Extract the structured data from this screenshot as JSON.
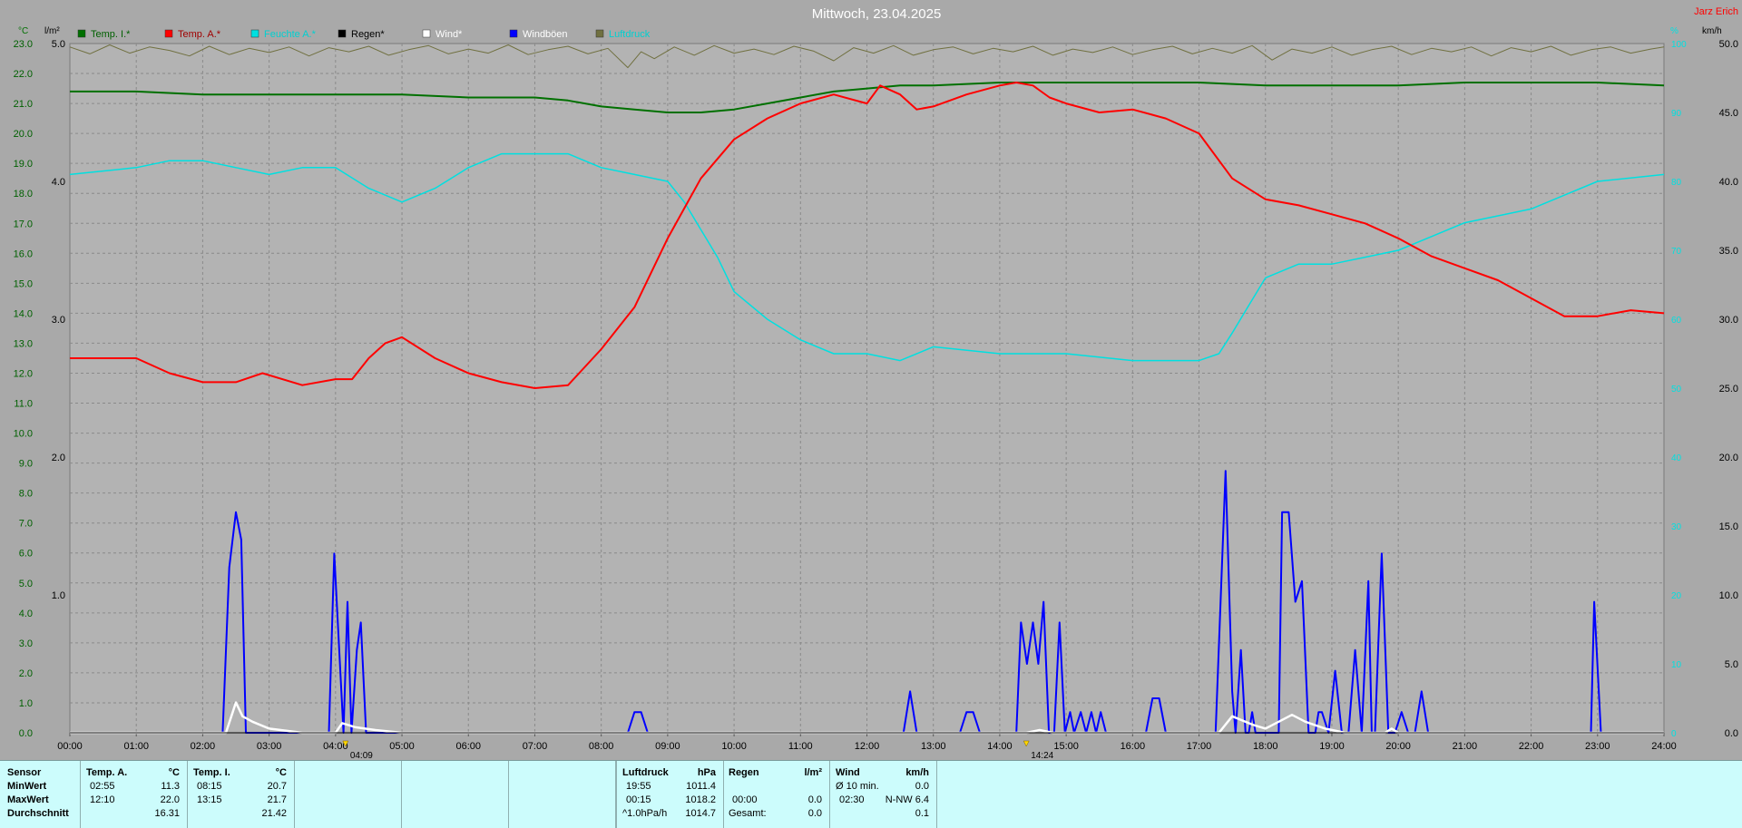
{
  "title": "Mittwoch, 23.04.2025",
  "author": "Jarz Erich",
  "units": {
    "temp": "°C",
    "rain": "l/m²",
    "wind": "km/h",
    "humidity": "%"
  },
  "colors": {
    "temp_inside": "#007000",
    "temp_outside": "#ff0000",
    "humidity": "#00e0e0",
    "rain": "#000000",
    "wind": "#ffffff",
    "gusts": "#0000ff",
    "pressure": "#707040"
  },
  "legend": [
    {
      "label": "Temp. I.*",
      "color": "#007000",
      "text_color": "#006000"
    },
    {
      "label": "Temp. A.*",
      "color": "#ff0000",
      "text_color": "#a00000"
    },
    {
      "label": "Feuchte A.*",
      "color": "#00e0e0",
      "text_color": "#00d0d0"
    },
    {
      "label": "Regen*",
      "color": "#000000",
      "text_color": "#000000"
    },
    {
      "label": "Wind*",
      "color": "#ffffff",
      "text_color": "#ffffff"
    },
    {
      "label": "Windböen",
      "color": "#0000ff",
      "text_color": "#ffffff"
    },
    {
      "label": "Luftdruck",
      "color": "#707040",
      "text_color": "#00d0d0"
    }
  ],
  "chart_data": {
    "type": "line",
    "x_ticks": [
      "00:00",
      "01:00",
      "02:00",
      "03:00",
      "04:00",
      "05:00",
      "06:00",
      "07:00",
      "08:00",
      "09:00",
      "10:00",
      "11:00",
      "12:00",
      "13:00",
      "14:00",
      "15:00",
      "16:00",
      "17:00",
      "18:00",
      "19:00",
      "20:00",
      "21:00",
      "22:00",
      "23:00",
      "24:00"
    ],
    "xlim_hours": [
      0,
      24
    ],
    "y_left_temp": {
      "label": "°C",
      "lim": [
        0,
        23
      ],
      "ticks": [
        "0.0",
        "1.0",
        "2.0",
        "3.0",
        "4.0",
        "5.0",
        "6.0",
        "7.0",
        "8.0",
        "9.0",
        "10.0",
        "11.0",
        "12.0",
        "13.0",
        "14.0",
        "15.0",
        "16.0",
        "17.0",
        "18.0",
        "19.0",
        "20.0",
        "21.0",
        "22.0",
        "23.0"
      ]
    },
    "y_left_rain": {
      "label": "l/m²",
      "lim": [
        0,
        5
      ],
      "ticks": [
        "0.0",
        "1.0",
        "2.0",
        "3.0",
        "4.0",
        "5.0"
      ]
    },
    "y_right_wind": {
      "label": "km/h",
      "lim": [
        0,
        50
      ],
      "ticks": [
        "0.0",
        "5.0",
        "10.0",
        "15.0",
        "20.0",
        "25.0",
        "30.0",
        "35.0",
        "40.0",
        "45.0",
        "50.0"
      ]
    },
    "y_right_humidity": {
      "label": "%",
      "lim": [
        0,
        100
      ],
      "ticks": [
        "0",
        "10",
        "20",
        "30",
        "40",
        "50",
        "60",
        "70",
        "80",
        "90",
        "100"
      ]
    },
    "grid": true,
    "markers": [
      {
        "hour": 4.15,
        "label": "04:09"
      },
      {
        "hour": 14.4,
        "label": "14:24"
      }
    ],
    "series": [
      {
        "name": "Temp. I.*",
        "axis": "temp",
        "color": "#007000",
        "x": [
          0,
          1,
          2,
          3,
          4,
          5,
          6,
          7,
          7.5,
          8,
          8.5,
          9,
          9.5,
          10,
          10.5,
          11,
          11.5,
          12,
          12.5,
          13,
          14,
          15,
          16,
          17,
          18,
          19,
          20,
          21,
          22,
          23,
          24
        ],
        "y": [
          21.4,
          21.4,
          21.3,
          21.3,
          21.3,
          21.3,
          21.2,
          21.2,
          21.1,
          20.9,
          20.8,
          20.7,
          20.7,
          20.8,
          21.0,
          21.2,
          21.4,
          21.5,
          21.6,
          21.6,
          21.7,
          21.7,
          21.7,
          21.7,
          21.6,
          21.6,
          21.6,
          21.7,
          21.7,
          21.7,
          21.6
        ]
      },
      {
        "name": "Temp. A.*",
        "axis": "temp",
        "color": "#ff0000",
        "x": [
          0,
          0.5,
          1,
          1.5,
          2,
          2.5,
          2.9,
          3.5,
          4,
          4.25,
          4.5,
          4.75,
          5,
          5.5,
          6,
          6.5,
          7,
          7.5,
          8,
          8.5,
          9,
          9.5,
          10,
          10.5,
          11,
          11.5,
          12,
          12.2,
          12.5,
          12.75,
          13,
          13.5,
          14,
          14.25,
          14.5,
          14.75,
          15,
          15.5,
          16,
          16.5,
          17,
          17.5,
          18,
          18.5,
          19,
          19.5,
          20,
          20.5,
          21,
          21.5,
          22,
          22.5,
          23,
          23.5,
          24
        ],
        "y": [
          12.5,
          12.5,
          12.5,
          12.0,
          11.7,
          11.7,
          12.0,
          11.6,
          11.8,
          11.8,
          12.5,
          13.0,
          13.2,
          12.5,
          12.0,
          11.7,
          11.5,
          11.6,
          12.8,
          14.2,
          16.5,
          18.5,
          19.8,
          20.5,
          21.0,
          21.3,
          21.0,
          21.6,
          21.3,
          20.8,
          20.9,
          21.3,
          21.6,
          21.7,
          21.6,
          21.2,
          21.0,
          20.7,
          20.8,
          20.5,
          20.0,
          18.5,
          17.8,
          17.6,
          17.3,
          17.0,
          16.5,
          15.9,
          15.5,
          15.1,
          14.5,
          13.9,
          13.9,
          14.1,
          14.0
        ]
      },
      {
        "name": "Feuchte A.*",
        "axis": "humidity",
        "color": "#00e0e0",
        "x": [
          0,
          1,
          1.5,
          2,
          2.5,
          3,
          3.5,
          4,
          4.5,
          5,
          5.5,
          6,
          6.5,
          7,
          7.5,
          8,
          8.5,
          9,
          9.25,
          9.5,
          9.75,
          10,
          10.5,
          11,
          11.5,
          12,
          12.5,
          13,
          14,
          15,
          16,
          17,
          17.3,
          17.5,
          17.75,
          18,
          18.5,
          19,
          19.5,
          20,
          20.5,
          21,
          21.5,
          22,
          22.5,
          23,
          24
        ],
        "y": [
          81,
          82,
          83,
          83,
          82,
          81,
          82,
          82,
          79,
          77,
          79,
          82,
          84,
          84,
          84,
          82,
          81,
          80,
          77,
          73,
          69,
          64,
          60,
          57,
          55,
          55,
          54,
          56,
          55,
          55,
          54,
          54,
          55,
          58,
          62,
          66,
          68,
          68,
          69,
          70,
          72,
          74,
          75,
          76,
          78,
          80,
          81
        ]
      },
      {
        "name": "Regen*",
        "axis": "rain",
        "color": "#000000",
        "x": [
          0,
          24
        ],
        "y": [
          0,
          0
        ]
      },
      {
        "name": "Wind*",
        "axis": "wind",
        "color": "#ffffff",
        "x": [
          0,
          2.35,
          2.5,
          2.6,
          2.75,
          3,
          3.5,
          4,
          4.1,
          4.3,
          4.6,
          5,
          14.4,
          14.6,
          14.8,
          17.3,
          17.5,
          17.8,
          18,
          18.4,
          18.6,
          18.9,
          19.2,
          19.8,
          19.9,
          20,
          24
        ],
        "y": [
          0,
          0,
          2.2,
          1.2,
          0.8,
          0.3,
          0,
          0,
          0.7,
          0.4,
          0.2,
          0,
          0,
          0.2,
          0,
          0,
          1.2,
          0.6,
          0.3,
          1.3,
          0.8,
          0.3,
          0,
          0,
          0.3,
          0,
          0
        ]
      },
      {
        "name": "Windböen",
        "axis": "wind",
        "color": "#0000ff",
        "x": [
          0,
          2.3,
          2.4,
          2.5,
          2.58,
          2.65,
          3.9,
          3.98,
          4.12,
          4.18,
          4.24,
          4.32,
          4.38,
          4.46,
          4.53,
          4.6,
          4.62,
          8.4,
          8.5,
          8.6,
          8.7,
          12.55,
          12.65,
          12.75,
          13.4,
          13.5,
          13.6,
          13.7,
          14.25,
          14.32,
          14.41,
          14.5,
          14.58,
          14.66,
          14.74,
          14.82,
          14.9,
          14.98,
          15.06,
          15.12,
          15.22,
          15.3,
          15.38,
          15.45,
          15.52,
          15.6,
          15.7,
          16.2,
          16.3,
          16.4,
          16.5,
          17.25,
          17.4,
          17.5,
          17.55,
          17.63,
          17.7,
          17.75,
          17.8,
          17.85,
          18.2,
          18.25,
          18.35,
          18.45,
          18.55,
          18.65,
          18.75,
          18.8,
          18.85,
          18.95,
          19.05,
          19.15,
          19.2,
          19.25,
          19.35,
          19.45,
          19.55,
          19.6,
          19.65,
          19.75,
          19.85,
          19.95,
          20.05,
          20.15,
          20.25,
          20.35,
          20.45,
          20.55,
          20.65,
          22.9,
          22.95,
          23.05,
          23.1,
          24
        ],
        "y": [
          0,
          0,
          12,
          16,
          14,
          0,
          0,
          13,
          0,
          9.5,
          0,
          6,
          8,
          0,
          0,
          0,
          0,
          0,
          1.5,
          1.5,
          0,
          0,
          3,
          0,
          0,
          1.5,
          1.5,
          0,
          0,
          8,
          5,
          8,
          5,
          9.5,
          0,
          0,
          8,
          0,
          1.5,
          0,
          1.5,
          0,
          1.5,
          0,
          1.5,
          0,
          0,
          0,
          2.5,
          2.5,
          0,
          0,
          19,
          3,
          0,
          6,
          0,
          0,
          1.5,
          0,
          0,
          16,
          16,
          9.5,
          11,
          0,
          0,
          1.5,
          1.5,
          0,
          4.5,
          0,
          0,
          0,
          6,
          0,
          11,
          0,
          0,
          13,
          0,
          0,
          1.5,
          0,
          0,
          3,
          0,
          0,
          0,
          0,
          9.5,
          0,
          0,
          0
        ]
      },
      {
        "name": "Luftdruck",
        "axis": "humidity",
        "color": "#707040",
        "x": [
          0,
          0.3,
          0.6,
          0.9,
          1.2,
          1.5,
          1.8,
          2.1,
          2.4,
          2.7,
          3.0,
          3.3,
          3.6,
          3.9,
          4.2,
          4.5,
          4.8,
          5.1,
          5.4,
          5.7,
          6.0,
          6.3,
          6.6,
          6.9,
          7.2,
          7.5,
          7.8,
          8.1,
          8.4,
          8.6,
          8.8,
          9.1,
          9.4,
          9.7,
          10.0,
          10.3,
          10.6,
          10.9,
          11.2,
          11.5,
          11.8,
          12.1,
          12.4,
          12.7,
          13.0,
          13.3,
          13.6,
          13.9,
          14.2,
          14.5,
          14.8,
          15.1,
          15.4,
          15.7,
          16.0,
          16.3,
          16.6,
          16.9,
          17.2,
          17.5,
          17.8,
          18.1,
          18.4,
          18.7,
          19.0,
          19.3,
          19.6,
          19.9,
          20.2,
          20.5,
          20.8,
          21.1,
          21.4,
          21.7,
          22.0,
          22.3,
          22.6,
          22.9,
          23.2,
          23.5,
          23.8,
          24
        ],
        "y": [
          99.5,
          98.5,
          99.8,
          98.6,
          99.5,
          99,
          98.2,
          99.6,
          98.4,
          99.3,
          98.7,
          99.5,
          98.2,
          99.4,
          98.8,
          99.6,
          98.3,
          99.1,
          99.7,
          98.5,
          99.2,
          98.6,
          99.8,
          98.4,
          99.1,
          99.6,
          98.5,
          99.3,
          96.5,
          98.8,
          97.8,
          99.5,
          98.3,
          99.7,
          98.6,
          99.2,
          98.4,
          99.6,
          98.9,
          97.5,
          99.4,
          98.6,
          99.7,
          98.3,
          99.1,
          99.5,
          98.5,
          99.3,
          98.8,
          99.6,
          98.3,
          99.2,
          98.7,
          99.5,
          98.4,
          99.1,
          99.6,
          98.5,
          99.3,
          98.6,
          99.7,
          97.6,
          99.2,
          98.6,
          99.5,
          98.3,
          99.1,
          99.6,
          98.4,
          99.3,
          98.8,
          99.5,
          98.2,
          99.4,
          98.8,
          99.6,
          98.3,
          99.1,
          99.5,
          98.6,
          99.2,
          99.5
        ]
      }
    ]
  },
  "stats_table": {
    "sensor_col": {
      "header": "Sensor",
      "rows": [
        "MinWert",
        "MaxWert",
        "Durchschnitt"
      ]
    },
    "temp_a": {
      "header": "Temp. A.",
      "unit": "°C",
      "rows": [
        {
          "time": "02:55",
          "value": "11.3"
        },
        {
          "time": "12:10",
          "value": "22.0"
        },
        {
          "time": "",
          "value": "16.31"
        }
      ]
    },
    "temp_i": {
      "header": "Temp. I.",
      "unit": "°C",
      "rows": [
        {
          "time": "08:15",
          "value": "20.7"
        },
        {
          "time": "13:15",
          "value": "21.7"
        },
        {
          "time": "",
          "value": "21.42"
        }
      ]
    },
    "pressure": {
      "header": "Luftdruck",
      "unit": "hPa",
      "rows": [
        {
          "time": "19:55",
          "value": "1011.4"
        },
        {
          "time": "00:15",
          "value": "1018.2"
        },
        {
          "time": "^1.0hPa/h",
          "value": "1014.7"
        }
      ]
    },
    "rain": {
      "header": "Regen",
      "unit": "l/m²",
      "rows": [
        {
          "time": "",
          "value": ""
        },
        {
          "time": "00:00",
          "value": "0.0"
        },
        {
          "time": "Gesamt:",
          "value": "0.0"
        }
      ]
    },
    "wind": {
      "header": "Wind",
      "unit": "km/h",
      "rows": [
        {
          "time": "Ø 10 min.",
          "value": "0.0"
        },
        {
          "time": "02:30",
          "value": "N-NW 6.4"
        },
        {
          "time": "",
          "value": "0.1"
        }
      ]
    }
  }
}
